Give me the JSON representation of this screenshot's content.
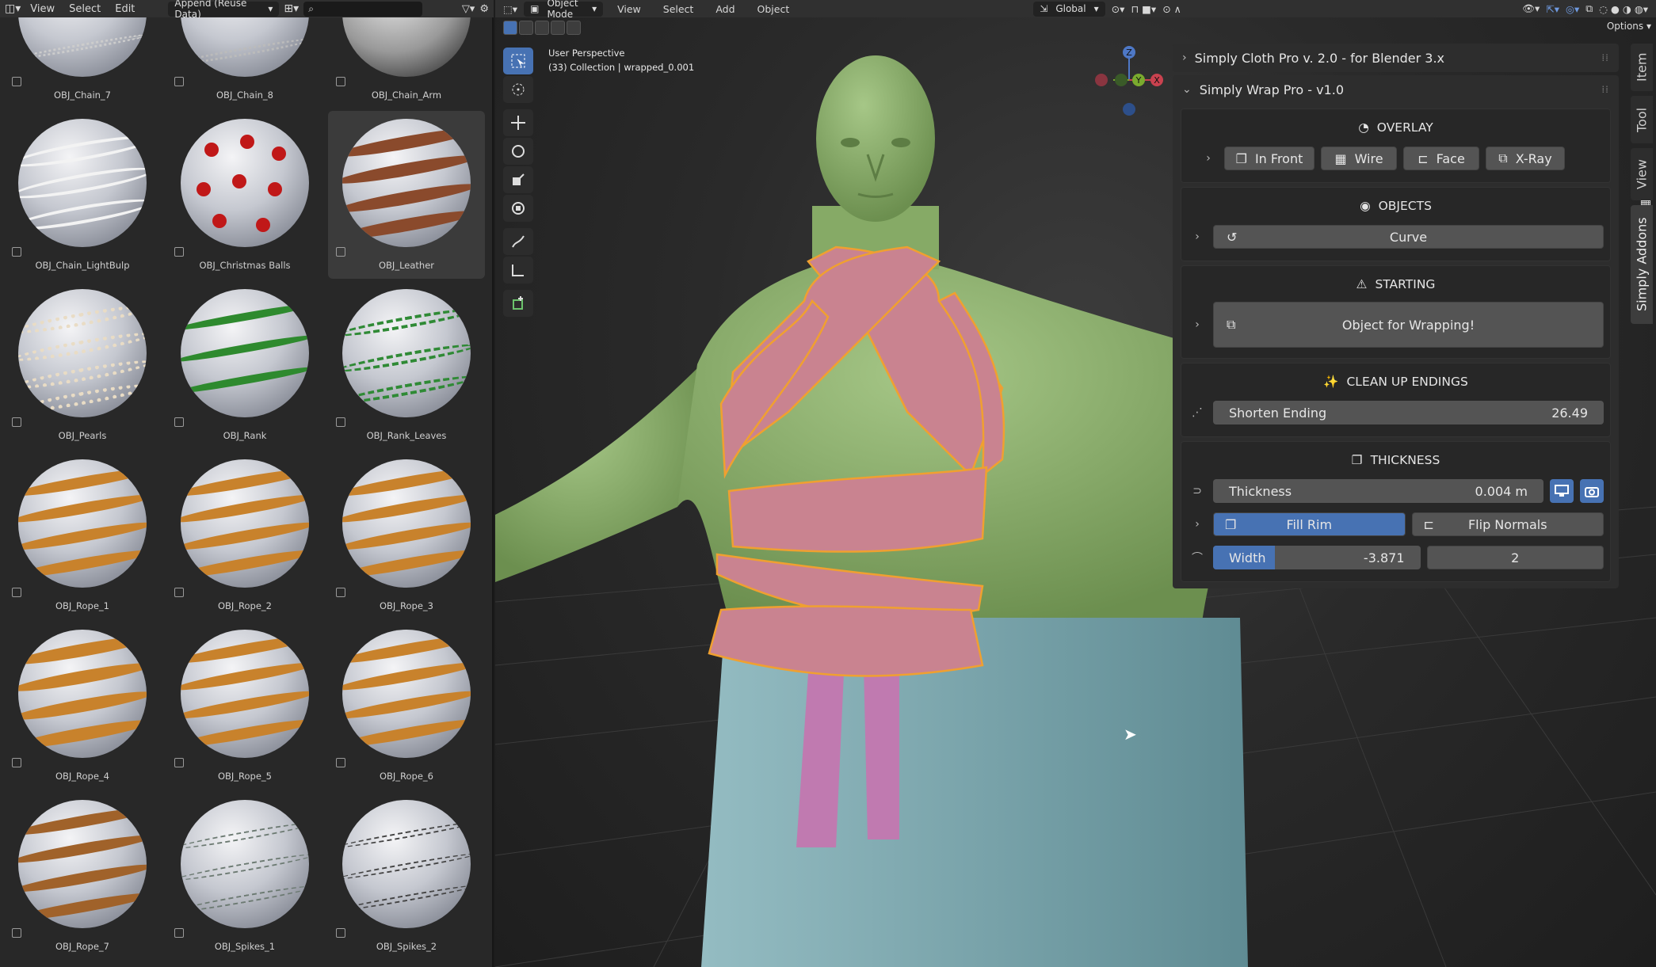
{
  "asset_browser": {
    "menus": [
      "View",
      "Select",
      "Edit"
    ],
    "import_mode": "Append (Reuse Data)",
    "search_value": "",
    "items": [
      {
        "name": "OBJ_Chain_7",
        "material": "chain"
      },
      {
        "name": "OBJ_Chain_8",
        "material": "chain"
      },
      {
        "name": "OBJ_Chain_Arm",
        "material": "chain-arm"
      },
      {
        "name": "OBJ_Chain_LightBulp",
        "material": "lightbulb"
      },
      {
        "name": "OBJ_Christmas Balls",
        "material": "christmas"
      },
      {
        "name": "OBJ_Leather",
        "material": "leather",
        "selected": true
      },
      {
        "name": "OBJ_Pearls",
        "material": "pearls"
      },
      {
        "name": "OBJ_Rank",
        "material": "rank"
      },
      {
        "name": "OBJ_Rank_Leaves",
        "material": "leaves"
      },
      {
        "name": "OBJ_Rope_1",
        "material": "rope"
      },
      {
        "name": "OBJ_Rope_2",
        "material": "rope"
      },
      {
        "name": "OBJ_Rope_3",
        "material": "rope"
      },
      {
        "name": "OBJ_Rope_4",
        "material": "rope"
      },
      {
        "name": "OBJ_Rope_5",
        "material": "rope"
      },
      {
        "name": "OBJ_Rope_6",
        "material": "rope"
      },
      {
        "name": "OBJ_Rope_7",
        "material": "rope-dark"
      },
      {
        "name": "OBJ_Spikes_1",
        "material": "spikes"
      },
      {
        "name": "OBJ_Spikes_2",
        "material": "spikes"
      }
    ]
  },
  "viewport": {
    "mode": "Object Mode",
    "menus": [
      "View",
      "Select",
      "Add",
      "Object"
    ],
    "orientation": "Global",
    "options_label": "Options",
    "perspective": "User Perspective",
    "collection_info": "(33) Collection | wrapped_0.001",
    "gizmo_axes": [
      "Z",
      "Y",
      "X"
    ]
  },
  "npanel": {
    "cloth_header": "Simply Cloth Pro v. 2.0 - for Blender 3.x",
    "wrap_header": "Simply Wrap Pro - v1.0",
    "overlay": {
      "title": "OVERLAY",
      "buttons": [
        "In Front",
        "Wire",
        "Face",
        "X-Ray"
      ]
    },
    "objects": {
      "title": "OBJECTS",
      "curve_label": "Curve"
    },
    "starting": {
      "title": "STARTING",
      "button_label": "Object for Wrapping!"
    },
    "cleanup": {
      "title": "CLEAN UP ENDINGS",
      "field_label": "Shorten Ending",
      "field_value": "26.49"
    },
    "thickness": {
      "title": "THICKNESS",
      "field_label": "Thickness",
      "field_value": "0.004 m",
      "fill_rim": "Fill Rim",
      "flip_normals": "Flip Normals",
      "width_label": "Width",
      "width_value": "-3.871",
      "width_fill": 0.3,
      "count_value": "2"
    }
  },
  "side_tabs": [
    "Item",
    "Tool",
    "View",
    "Simply Addons"
  ],
  "colors": {
    "accent": "#4772b3",
    "skin": "#8fb36d",
    "wrap": "#c98390",
    "pants": "#7eaab2",
    "selection_outline": "#f0a030"
  }
}
